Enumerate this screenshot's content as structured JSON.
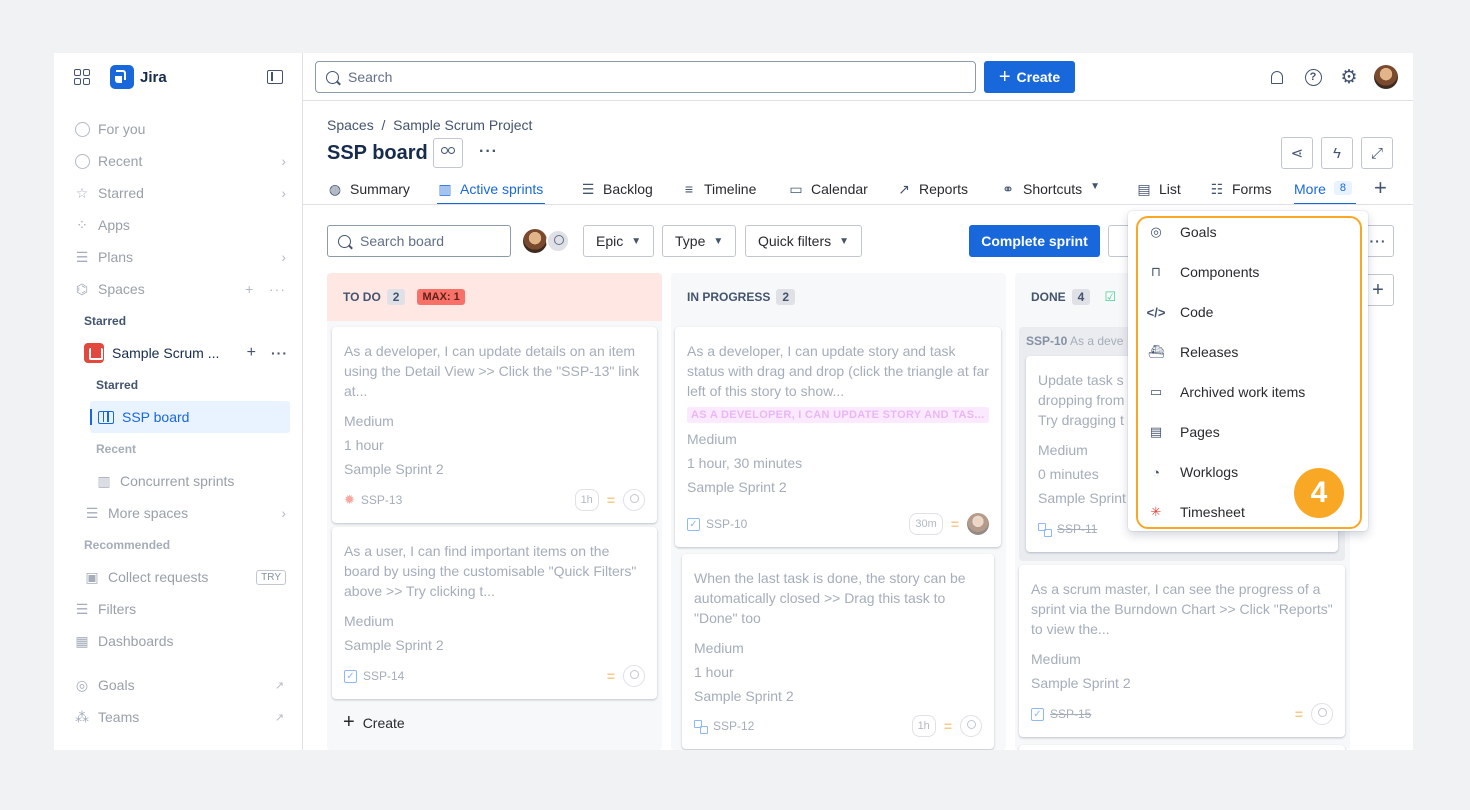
{
  "sidebar": {
    "app_name": "Jira",
    "nav": [
      {
        "label": "For you"
      },
      {
        "label": "Recent"
      },
      {
        "label": "Starred"
      },
      {
        "label": "Apps"
      },
      {
        "label": "Plans"
      },
      {
        "label": "Spaces"
      }
    ],
    "starred_label": "Starred",
    "project_name": "Sample Scrum ...",
    "project_starred_label": "Starred",
    "active_board": "SSP board",
    "recent_label": "Recent",
    "recent_item": "Concurrent sprints",
    "more_spaces": "More spaces",
    "recommended_label": "Recommended",
    "collect_requests": "Collect requests",
    "try_badge": "TRY",
    "filters": "Filters",
    "dashboards": "Dashboards",
    "goals": "Goals",
    "teams": "Teams"
  },
  "topbar": {
    "search_placeholder": "Search",
    "create_label": "Create"
  },
  "header": {
    "breadcrumb": "Spaces  /  Sample Scrum Project",
    "title": "SSP board"
  },
  "tabs": [
    {
      "label": "Summary"
    },
    {
      "label": "Active sprints"
    },
    {
      "label": "Backlog"
    },
    {
      "label": "Timeline"
    },
    {
      "label": "Calendar"
    },
    {
      "label": "Reports"
    },
    {
      "label": "Shortcuts"
    },
    {
      "label": "List"
    },
    {
      "label": "Forms"
    },
    {
      "label": "More",
      "count": "8"
    }
  ],
  "toolbar": {
    "search_board_placeholder": "Search board",
    "epic": "Epic",
    "type": "Type",
    "quick_filters": "Quick filters",
    "complete_sprint": "Complete sprint"
  },
  "columns": {
    "todo": {
      "name": "TO DO",
      "count": "2",
      "max": "MAX: 1"
    },
    "in_progress": {
      "name": "IN PROGRESS",
      "count": "2"
    },
    "done": {
      "name": "DONE",
      "count": "4"
    }
  },
  "cards": {
    "c13": {
      "text": "As a developer, I can update details on an item using the Detail View >> Click the \"SSP-13\" link at...",
      "priority": "Medium",
      "estimate": "1 hour",
      "sprint": "Sample Sprint 2",
      "key": "SSP-13",
      "est_badge": "1h"
    },
    "c14": {
      "text": "As a user, I can find important items on the board by using the customisable \"Quick Filters\" above >> Try clicking t...",
      "priority": "Medium",
      "sprint": "Sample Sprint 2",
      "key": "SSP-14"
    },
    "c10": {
      "text": "As a developer, I can update story and task status with drag and drop (click the triangle at far left of this story to show...",
      "label": "AS A DEVELOPER, I CAN UPDATE STORY AND TAS...",
      "priority": "Medium",
      "estimate": "1 hour, 30 minutes",
      "sprint": "Sample Sprint 2",
      "key": "SSP-10",
      "est_badge": "30m"
    },
    "c12": {
      "text": "When the last task is done, the story can be automatically closed >> Drag this task to \"Done\" too",
      "priority": "Medium",
      "estimate": "1 hour",
      "sprint": "Sample Sprint 2",
      "key": "SSP-12",
      "est_badge": "1h"
    },
    "c11": {
      "text": "Update task status by dragging and dropping from column to column >> Try dragging this task to \"Done\"",
      "line1": "Update task s",
      "line2": "dropping from",
      "line3": "Try dragging t",
      "priority": "Medium",
      "estimate": "0 minutes",
      "sprint": "Sample Sprint",
      "key": "SSP-11"
    },
    "c15": {
      "text": "As a scrum master, I can see the progress of a sprint via the Burndown Chart >> Click \"Reports\" to view the...",
      "priority": "Medium",
      "sprint": "Sample Sprint 2",
      "key": "SSP-15"
    }
  },
  "done_group": {
    "key": "SSP-10",
    "text": "As a deve"
  },
  "column_create": "Create",
  "dropdown": [
    {
      "label": "Goals",
      "icon": "goal-icon"
    },
    {
      "label": "Components",
      "icon": "component-icon"
    },
    {
      "label": "Code",
      "icon": "code-icon"
    },
    {
      "label": "Releases",
      "icon": "release-icon"
    },
    {
      "label": "Archived work items",
      "icon": "archive-icon"
    },
    {
      "label": "Pages",
      "icon": "page-icon"
    },
    {
      "label": "Worklogs",
      "icon": "clock-icon"
    },
    {
      "label": "Timesheet",
      "icon": "timesheet-icon"
    }
  ],
  "step_badge": "4",
  "colors": {
    "brand": "#1868db",
    "highlight": "#f9a825"
  }
}
